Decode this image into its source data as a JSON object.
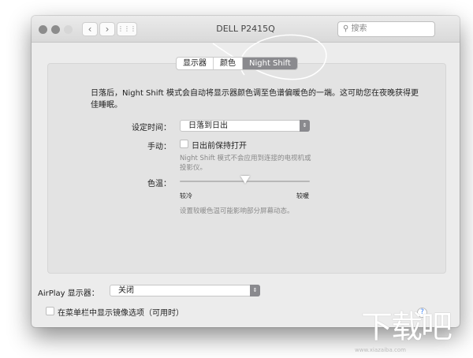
{
  "window": {
    "title": "DELL P2415Q",
    "search_placeholder": "搜索",
    "back": "‹",
    "forward": "›",
    "grid": "⋮⋮⋮"
  },
  "tabs": [
    {
      "label": "显示器"
    },
    {
      "label": "颜色"
    },
    {
      "label": "Night Shift",
      "active": true
    }
  ],
  "description": "日落后，Night Shift 模式会自动将显示器颜色调至色谱偏暖色的一端。这可助您在夜晚获得更佳睡眠。",
  "schedule": {
    "label": "设定时间：",
    "value": "日落到日出"
  },
  "manual": {
    "label": "手动：",
    "checkbox_label": "日出前保持打开",
    "checked": false,
    "note": "Night Shift 模式不会应用到连接的电视机或投影仪。"
  },
  "temperature": {
    "label": "色温：",
    "min_label": "较冷",
    "max_label": "较暖",
    "value": 0.5,
    "note": "设置较暖色温可能影响部分屏幕动态。"
  },
  "airplay": {
    "label": "AirPlay 显示器：",
    "value": "关闭"
  },
  "mirror": {
    "label": "在菜单栏中显示镜像选项（可用时）",
    "checked": false
  },
  "help": "?",
  "watermark": {
    "logo": "下载吧",
    "url": "www.xiazaiba.com"
  }
}
